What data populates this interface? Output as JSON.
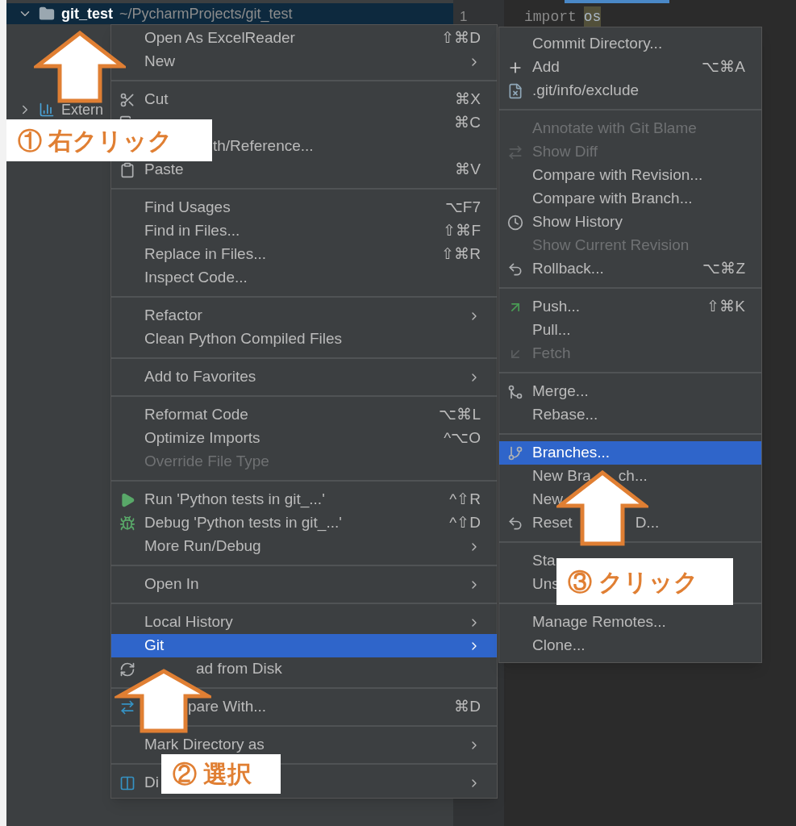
{
  "project_tree": [
    {
      "name": "git_test",
      "path": "~/PycharmProjects/git_test",
      "expanded": true,
      "selected": true
    },
    {
      "name": "Extern",
      "expanded": false,
      "selected": false
    }
  ],
  "editor": {
    "line_numbers": [
      "1"
    ],
    "code_tokens": [
      {
        "text": "import",
        "kind": "keyword"
      },
      {
        "text": "os",
        "kind": "highlighted"
      }
    ]
  },
  "context_menu": {
    "sections": [
      {
        "items": [
          {
            "label": "Open As ExcelReader",
            "shortcut": "⇧⌘D"
          },
          {
            "label": "New",
            "submenu": true
          }
        ]
      },
      {
        "items": [
          {
            "label": "Cut",
            "shortcut": "⌘X"
          },
          {
            "shortcut": "⌘C"
          },
          {
            "tail": "th/Reference..."
          },
          {
            "label": "Paste",
            "shortcut": "⌘V"
          }
        ]
      },
      {
        "items": [
          {
            "label": "Find Usages",
            "shortcut": "⌥F7"
          },
          {
            "label": "Find in Files...",
            "shortcut": "⇧⌘F"
          },
          {
            "label": "Replace in Files...",
            "shortcut": "⇧⌘R"
          },
          {
            "label": "Inspect Code..."
          }
        ]
      },
      {
        "items": [
          {
            "label": "Refactor",
            "submenu": true
          },
          {
            "label": "Clean Python Compiled Files"
          }
        ]
      },
      {
        "items": [
          {
            "label": "Add to Favorites",
            "submenu": true
          }
        ]
      },
      {
        "items": [
          {
            "label": "Reformat Code",
            "shortcut": "⌥⌘L"
          },
          {
            "label": "Optimize Imports",
            "shortcut": "^⌥O"
          },
          {
            "label": "Override File Type",
            "disabled": true
          }
        ]
      },
      {
        "items": [
          {
            "label": "Run 'Python tests in git_...'",
            "shortcut": "^⇧R"
          },
          {
            "label": "Debug 'Python tests in git_...'",
            "shortcut": "^⇧D"
          },
          {
            "label": "More Run/Debug",
            "submenu": true
          }
        ]
      },
      {
        "items": [
          {
            "label": "Open In",
            "submenu": true
          }
        ]
      },
      {
        "items": [
          {
            "label": "Local History",
            "submenu": true,
            "selected": false
          },
          {
            "label": "Git",
            "submenu": true,
            "selected": true
          },
          {
            "tail": "ad from Disk",
            "selected": false
          }
        ]
      },
      {
        "items": [
          {
            "tail": "pare With...",
            "shortcut": "⌘D"
          }
        ]
      },
      {
        "items": [
          {
            "label": "Mark Directory as",
            "submenu": true
          }
        ]
      },
      {
        "items": [
          {
            "label": "Di",
            "submenu": true
          }
        ]
      }
    ]
  },
  "git_submenu": {
    "sections": [
      {
        "items": [
          {
            "label": "Commit Directory..."
          },
          {
            "label": "Add",
            "shortcut": "⌥⌘A"
          },
          {
            "label": ".git/info/exclude"
          }
        ]
      },
      {
        "items": [
          {
            "label": "Annotate with Git Blame",
            "disabled": true
          },
          {
            "label": "Show Diff",
            "disabled": true
          },
          {
            "label": "Compare with Revision...",
            "disabled": false
          },
          {
            "label": "Compare with Branch...",
            "disabled": false
          },
          {
            "label": "Show History",
            "disabled": false
          },
          {
            "label": "Show Current Revision",
            "disabled": true
          },
          {
            "label": "Rollback...",
            "shortcut": "⌥⌘Z",
            "disabled": false
          }
        ]
      },
      {
        "items": [
          {
            "label": "Push...",
            "shortcut": "⇧⌘K",
            "disabled": false
          },
          {
            "label": "Pull...",
            "disabled": false
          },
          {
            "label": "Fetch",
            "disabled": true
          }
        ]
      },
      {
        "items": [
          {
            "label": "Merge..."
          },
          {
            "label": "Rebase..."
          }
        ]
      },
      {
        "items": [
          {
            "label": "Branches...",
            "selected": true
          },
          {
            "label": "New Bra",
            "tail": "ch...",
            "selected": false
          },
          {
            "label": "New",
            "selected": false
          },
          {
            "label": "Reset",
            "tail": "D...",
            "selected": false
          }
        ]
      },
      {
        "items": [
          {
            "label": "Sta"
          },
          {
            "label": "Uns"
          }
        ]
      },
      {
        "items": [
          {
            "label": "Manage Remotes..."
          },
          {
            "label": "Clone..."
          }
        ]
      }
    ]
  },
  "annotations": [
    {
      "text": "① 右クリック"
    },
    {
      "text": "② 選択"
    },
    {
      "text": "③ クリック"
    }
  ]
}
